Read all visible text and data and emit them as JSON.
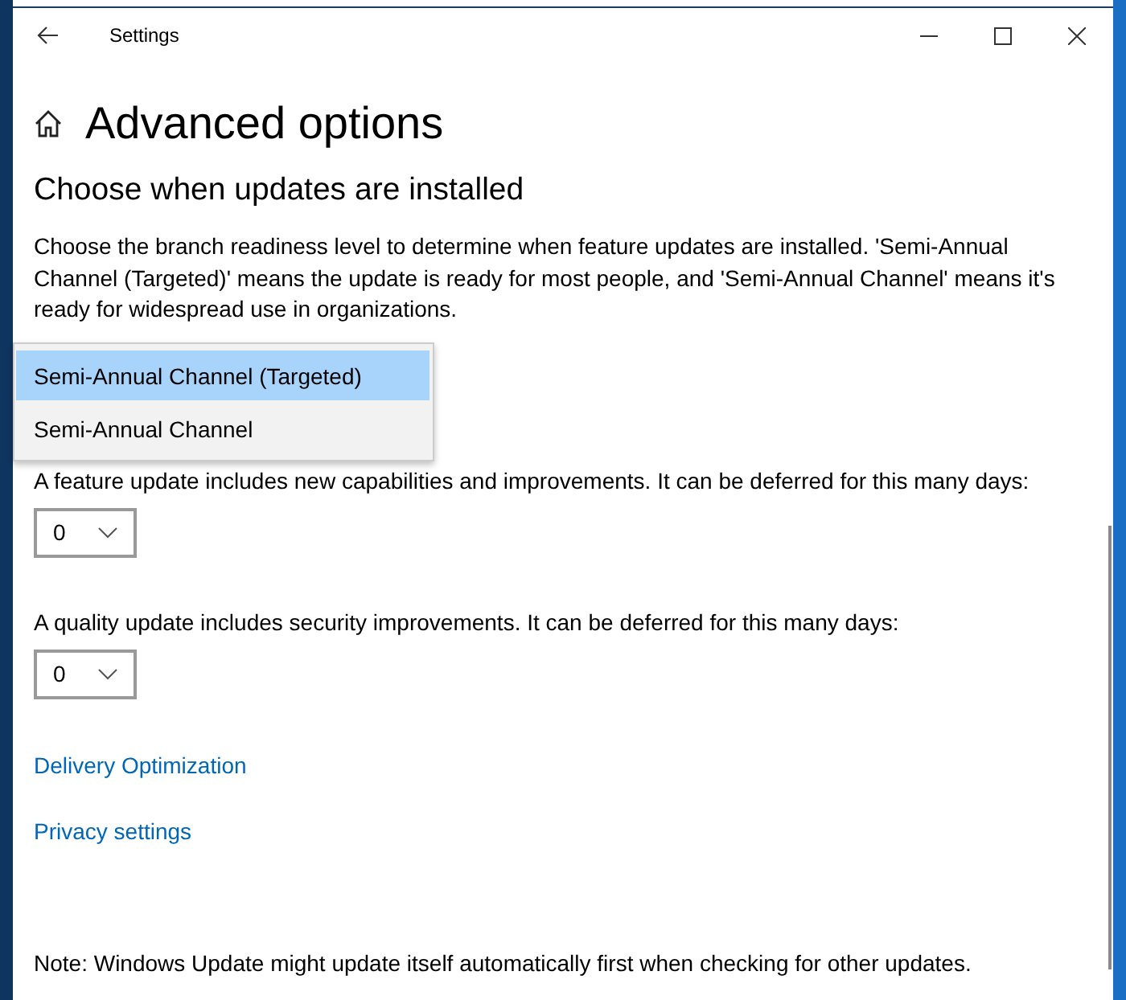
{
  "window": {
    "title": "Settings"
  },
  "page": {
    "title": "Advanced options"
  },
  "section": {
    "heading": "Choose when updates are installed",
    "description": "Choose the branch readiness level to determine when feature updates are installed. 'Semi-Annual Channel (Targeted)' means the update is ready for most people, and 'Semi-Annual Channel' means it's ready for widespread use in organizations."
  },
  "branch_dropdown": {
    "expanded": true,
    "options": [
      {
        "label": "Semi-Annual Channel (Targeted)",
        "selected": true
      },
      {
        "label": "Semi-Annual Channel",
        "selected": false
      }
    ]
  },
  "deferrals": [
    {
      "label": "A feature update includes new capabilities and improvements. It can be deferred for this many days:",
      "value": "0"
    },
    {
      "label": "A quality update includes security improvements. It can be deferred for this many days:",
      "value": "0"
    }
  ],
  "links": [
    "Delivery Optimization",
    "Privacy settings"
  ],
  "note": "Note: Windows Update might update itself automatically first when checking for other updates."
}
